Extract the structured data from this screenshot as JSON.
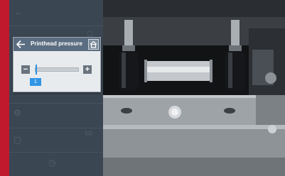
{
  "dialog": {
    "title": "Printhead pressure",
    "value": "1",
    "slider_level_fraction": 0.02
  },
  "colors": {
    "accent": "#c0182d",
    "header": "#5b6d80",
    "slider_handle": "#2e90e0"
  },
  "icons": {
    "back": "arrow-left-icon",
    "home": "home-icon",
    "minus": "minus-icon",
    "plus": "plus-icon"
  }
}
